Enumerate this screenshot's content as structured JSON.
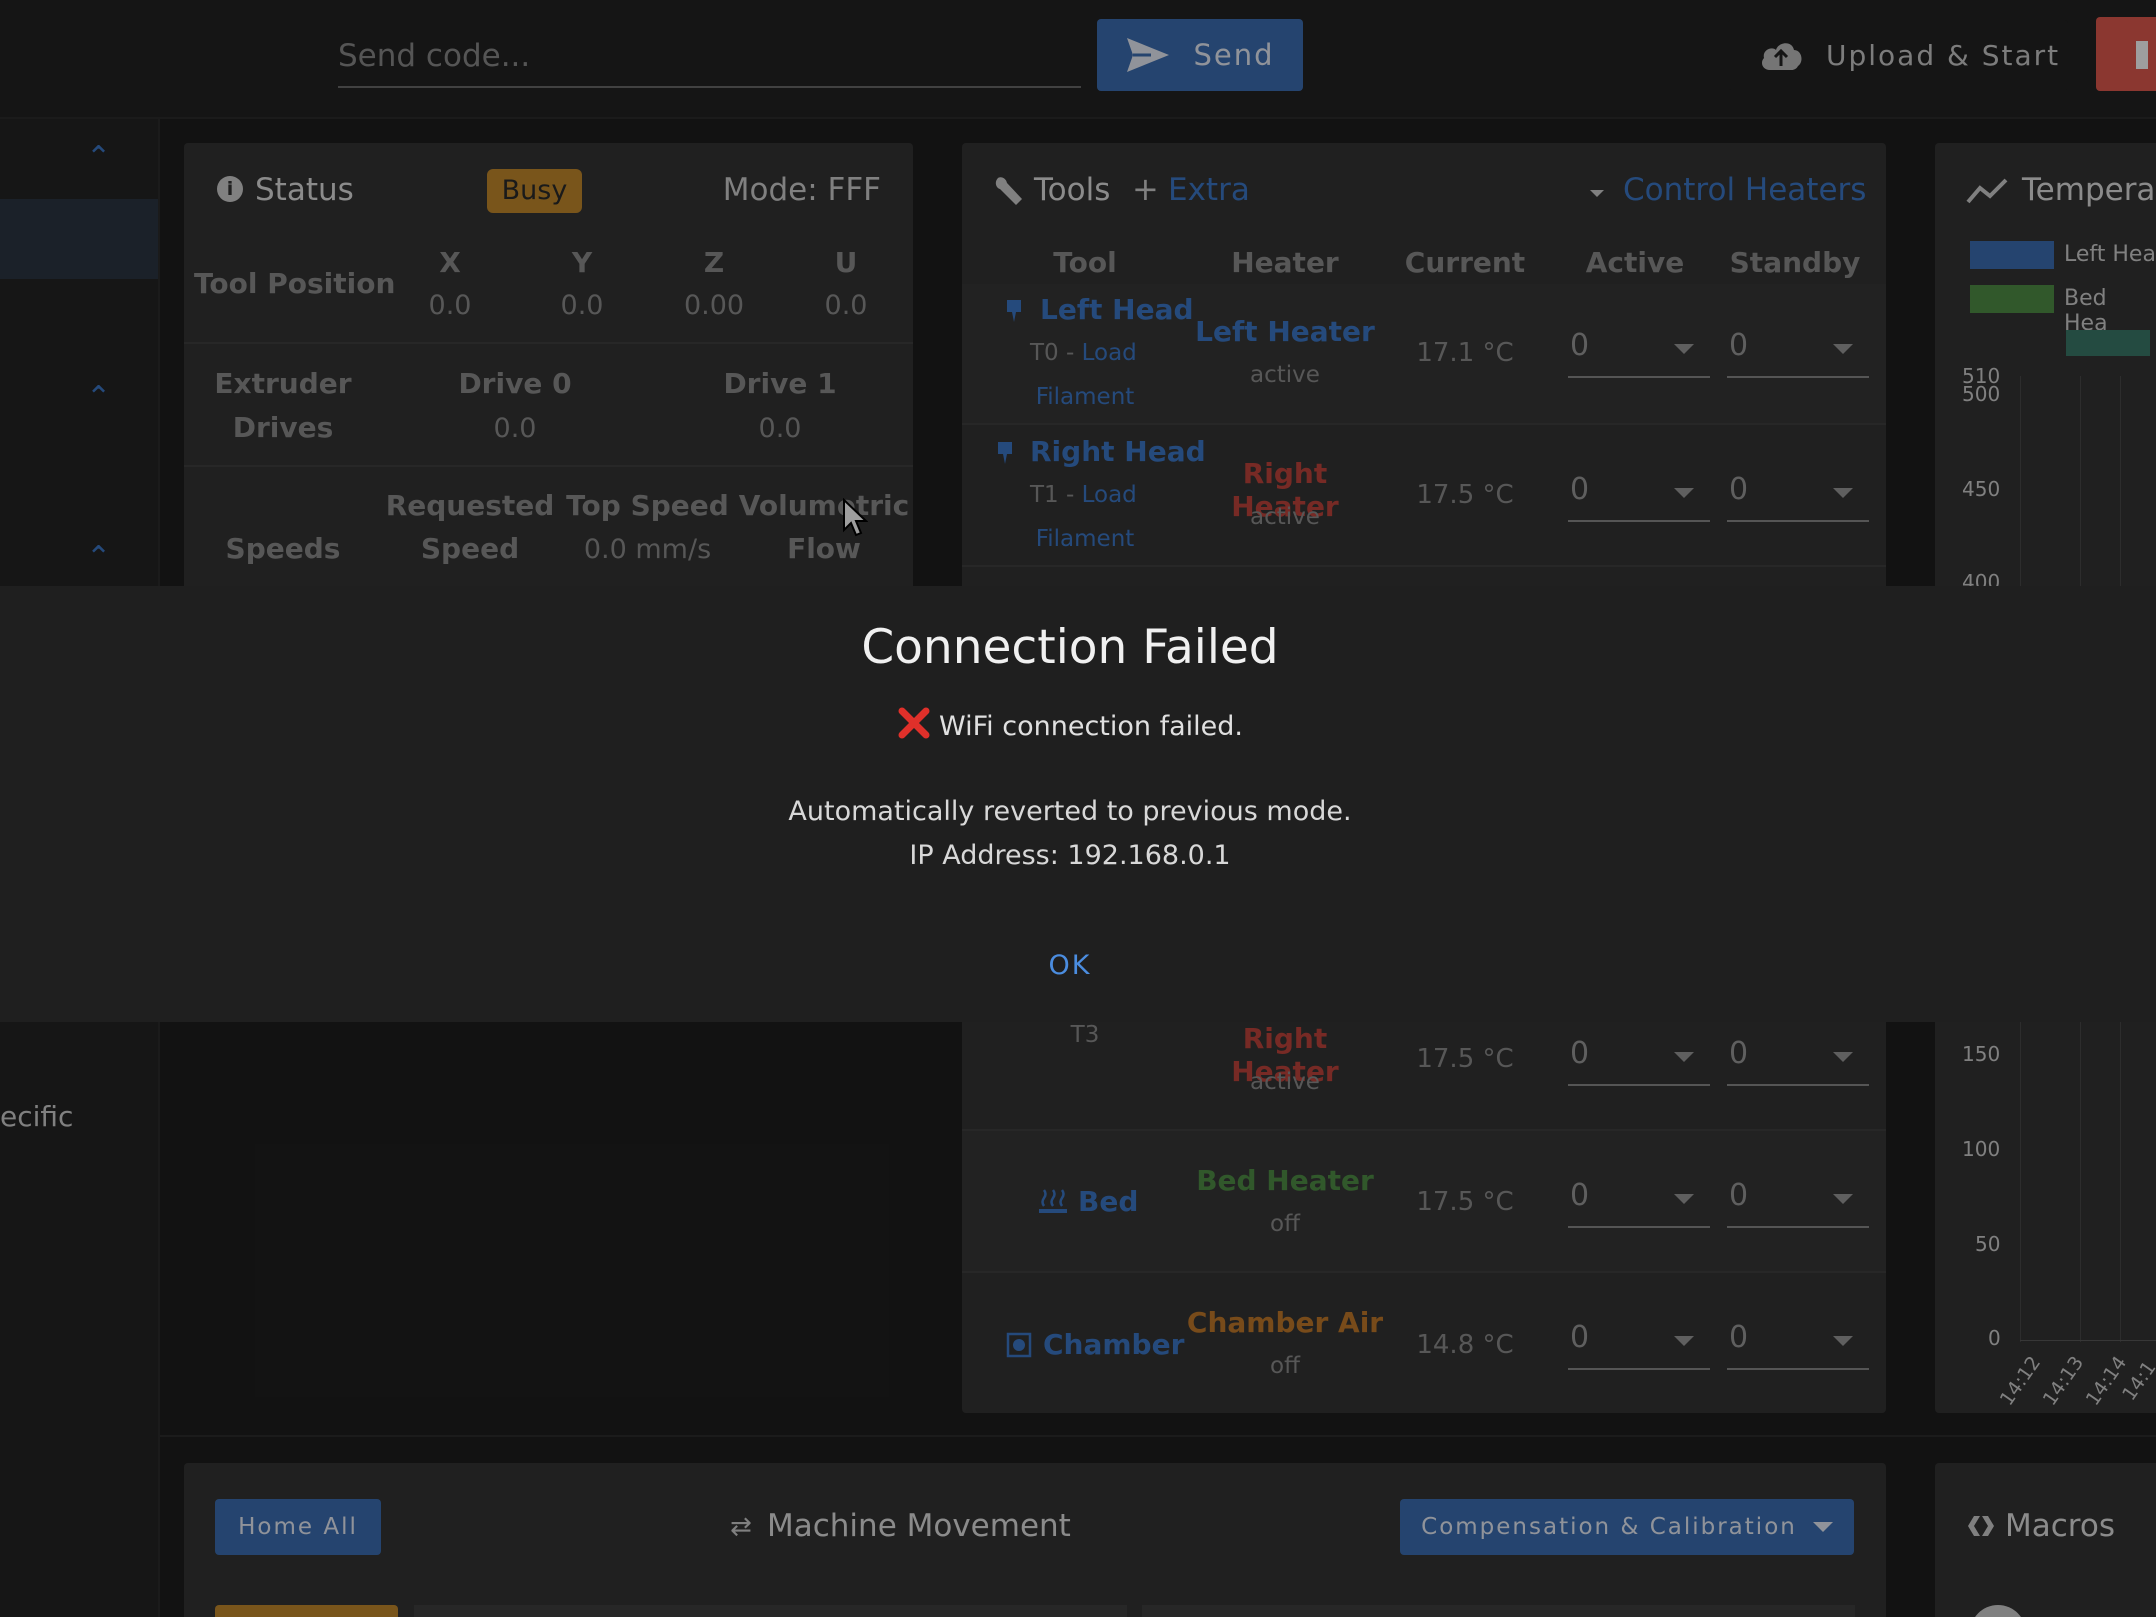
{
  "topbar": {
    "send_placeholder": "Send code...",
    "send_label": "Send",
    "upload_label": "Upload & Start"
  },
  "sidebar": {
    "partial_label": "ecific"
  },
  "status": {
    "title": "Status",
    "badge": "Busy",
    "mode": "Mode: FFF",
    "tool_position_label": "Tool Position",
    "axes": [
      {
        "name": "X",
        "value": "0.0"
      },
      {
        "name": "Y",
        "value": "0.0"
      },
      {
        "name": "Z",
        "value": "0.00"
      },
      {
        "name": "U",
        "value": "0.0"
      }
    ],
    "extruder_label_1": "Extruder",
    "extruder_label_2": "Drives",
    "drives": [
      {
        "name": "Drive 0",
        "value": "0.0"
      },
      {
        "name": "Drive 1",
        "value": "0.0"
      }
    ],
    "speeds_label": "Speeds",
    "requested_1": "Requested",
    "requested_2": "Speed",
    "top_speed": "Top Speed",
    "top_speed_value": "0.0 mm/s",
    "volumetric_1": "Volumetric",
    "volumetric_2": "Flow"
  },
  "tools": {
    "title": "Tools",
    "extra": "Extra",
    "control_heaters": "Control Heaters",
    "columns": [
      "Tool",
      "Heater",
      "Current",
      "Active",
      "Standby"
    ],
    "rows": [
      {
        "tool": "Left Head",
        "sub_prefix": "T0 - ",
        "sub_link": "Load",
        "sub_link2": "Filament",
        "heater": "Left Heater",
        "heater_state": "active",
        "current": "17.1 °C",
        "active": "0",
        "standby": "0",
        "heater_color": "#3d78c8"
      },
      {
        "tool": "Right Head",
        "sub_prefix": "T1 - ",
        "sub_link": "Load",
        "sub_link2": "Filament",
        "heater": "Right Heater",
        "heater_state": "active",
        "current": "17.5 °C",
        "active": "0",
        "standby": "0",
        "heater_color": "#c0453c"
      },
      {
        "tool": "",
        "sub_prefix": "T3",
        "heater": "Right Heater",
        "heater_state": "active",
        "current": "17.5 °C",
        "active": "0",
        "standby": "0",
        "heater_color": "#c0453c"
      },
      {
        "tool": "Bed",
        "heater": "Bed Heater",
        "heater_state": "off",
        "current": "17.5 °C",
        "active": "0",
        "standby": "0",
        "heater_color": "#4f8f46"
      },
      {
        "tool": "Chamber",
        "heater": "Chamber Air",
        "heater_state": "off",
        "current": "14.8 °C",
        "active": "0",
        "standby": "0",
        "heater_color": "#c27a2a"
      }
    ]
  },
  "temperature": {
    "title": "Temperat",
    "legend": [
      {
        "name": "Left Hea",
        "color": "#3d6fb3"
      },
      {
        "name": "Bed Hea",
        "color": "#4f8f46"
      }
    ],
    "y_ticks_top": [
      "510",
      "500",
      "450",
      "400"
    ],
    "y_ticks_bottom": [
      "150",
      "100",
      "50",
      "0"
    ],
    "x_ticks": [
      "14:12",
      "14:13",
      "14:14",
      "14:1"
    ]
  },
  "movement": {
    "home_all": "Home All",
    "title": "Machine Movement",
    "compensation": "Compensation & Calibration"
  },
  "macros": {
    "title": "Macros"
  },
  "dialog": {
    "title": "Connection Failed",
    "error_icon": "x-icon",
    "line1": "WiFi connection failed.",
    "line2": "Automatically reverted to previous mode.",
    "line3": "IP Address: 192.168.0.1",
    "ok": "OK"
  }
}
